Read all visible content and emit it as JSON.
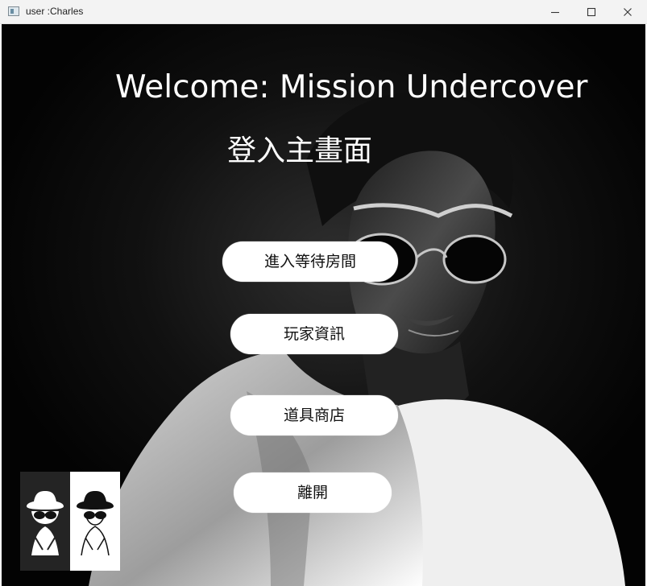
{
  "window": {
    "title": "user :Charles",
    "controls": [
      "minimize-icon",
      "maximize-icon",
      "close-icon"
    ]
  },
  "main": {
    "heading": "Welcome: Mission Undercover",
    "subheading": "登入主畫面",
    "buttons": [
      {
        "label": "進入等待房間"
      },
      {
        "label": "玩家資訊"
      },
      {
        "label": "道具商店"
      },
      {
        "label": "離開"
      }
    ],
    "avatar_icons": [
      "spy-dark-icon",
      "spy-light-icon"
    ]
  },
  "colors": {
    "background": "#050505",
    "text": "#ffffff",
    "button": "#ffffff",
    "titlebar": "#f3f3f3"
  }
}
